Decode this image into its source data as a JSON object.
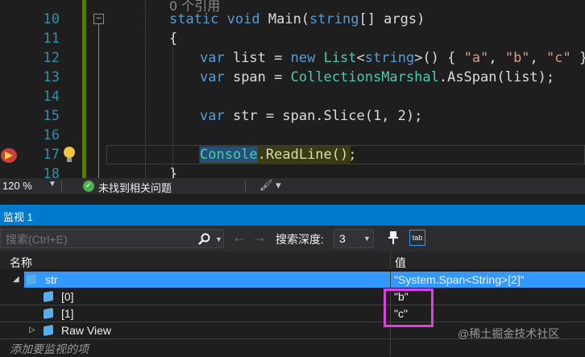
{
  "editor": {
    "line_numbers": [
      "10",
      "11",
      "12",
      "13",
      "14",
      "15",
      "16",
      "17",
      "18"
    ],
    "ref_hint": "0 个引用",
    "colors": {
      "keyword": "#569cd6",
      "type": "#4ec9b0",
      "string": "#d69d85",
      "line_number": "#2b91af"
    }
  },
  "code": {
    "l10_static": "static",
    "l10_void": "void",
    "l10_rest": " Main(",
    "l10_string": "string",
    "l10_end": "[] args)",
    "l11": "{",
    "l12_var": "var",
    "l12_list": " list = ",
    "l12_new": "new",
    "l12_type": "List",
    "l12_lt": "<",
    "l12_string": "string",
    "l12_gt": ">() { ",
    "l12_a": "\"a\"",
    "l12_c1": ", ",
    "l12_b": "\"b\"",
    "l12_c2": ", ",
    "l12_c": "\"c\"",
    "l12_end": " };",
    "l13_var": "var",
    "l13_span": " span = ",
    "l13_type": "CollectionsMarshal",
    "l13_end": ".AsSpan(list);",
    "l15_var": "var",
    "l15_rest": " str = span.Slice(1, 2);",
    "l17_console": "Console",
    "l17_rest": ".ReadLine();",
    "l18": "}"
  },
  "status": {
    "zoom": "120 %",
    "issues": "未找到相关问题"
  },
  "watch": {
    "title": "监视 1",
    "search_placeholder": "搜索(Ctrl+E)",
    "depth_label": "搜索深度:",
    "depth_value": "3",
    "col_name": "名称",
    "col_value": "值",
    "rows": [
      {
        "name": "str",
        "value": "\"System.Span<String>[2]\""
      },
      {
        "name": "[0]",
        "value": "\"b\""
      },
      {
        "name": "[1]",
        "value": "\"c\""
      },
      {
        "name": "Raw View",
        "value": ""
      }
    ],
    "add_item": "添加要监视的项"
  },
  "watermark": "@稀土掘金技术社区"
}
